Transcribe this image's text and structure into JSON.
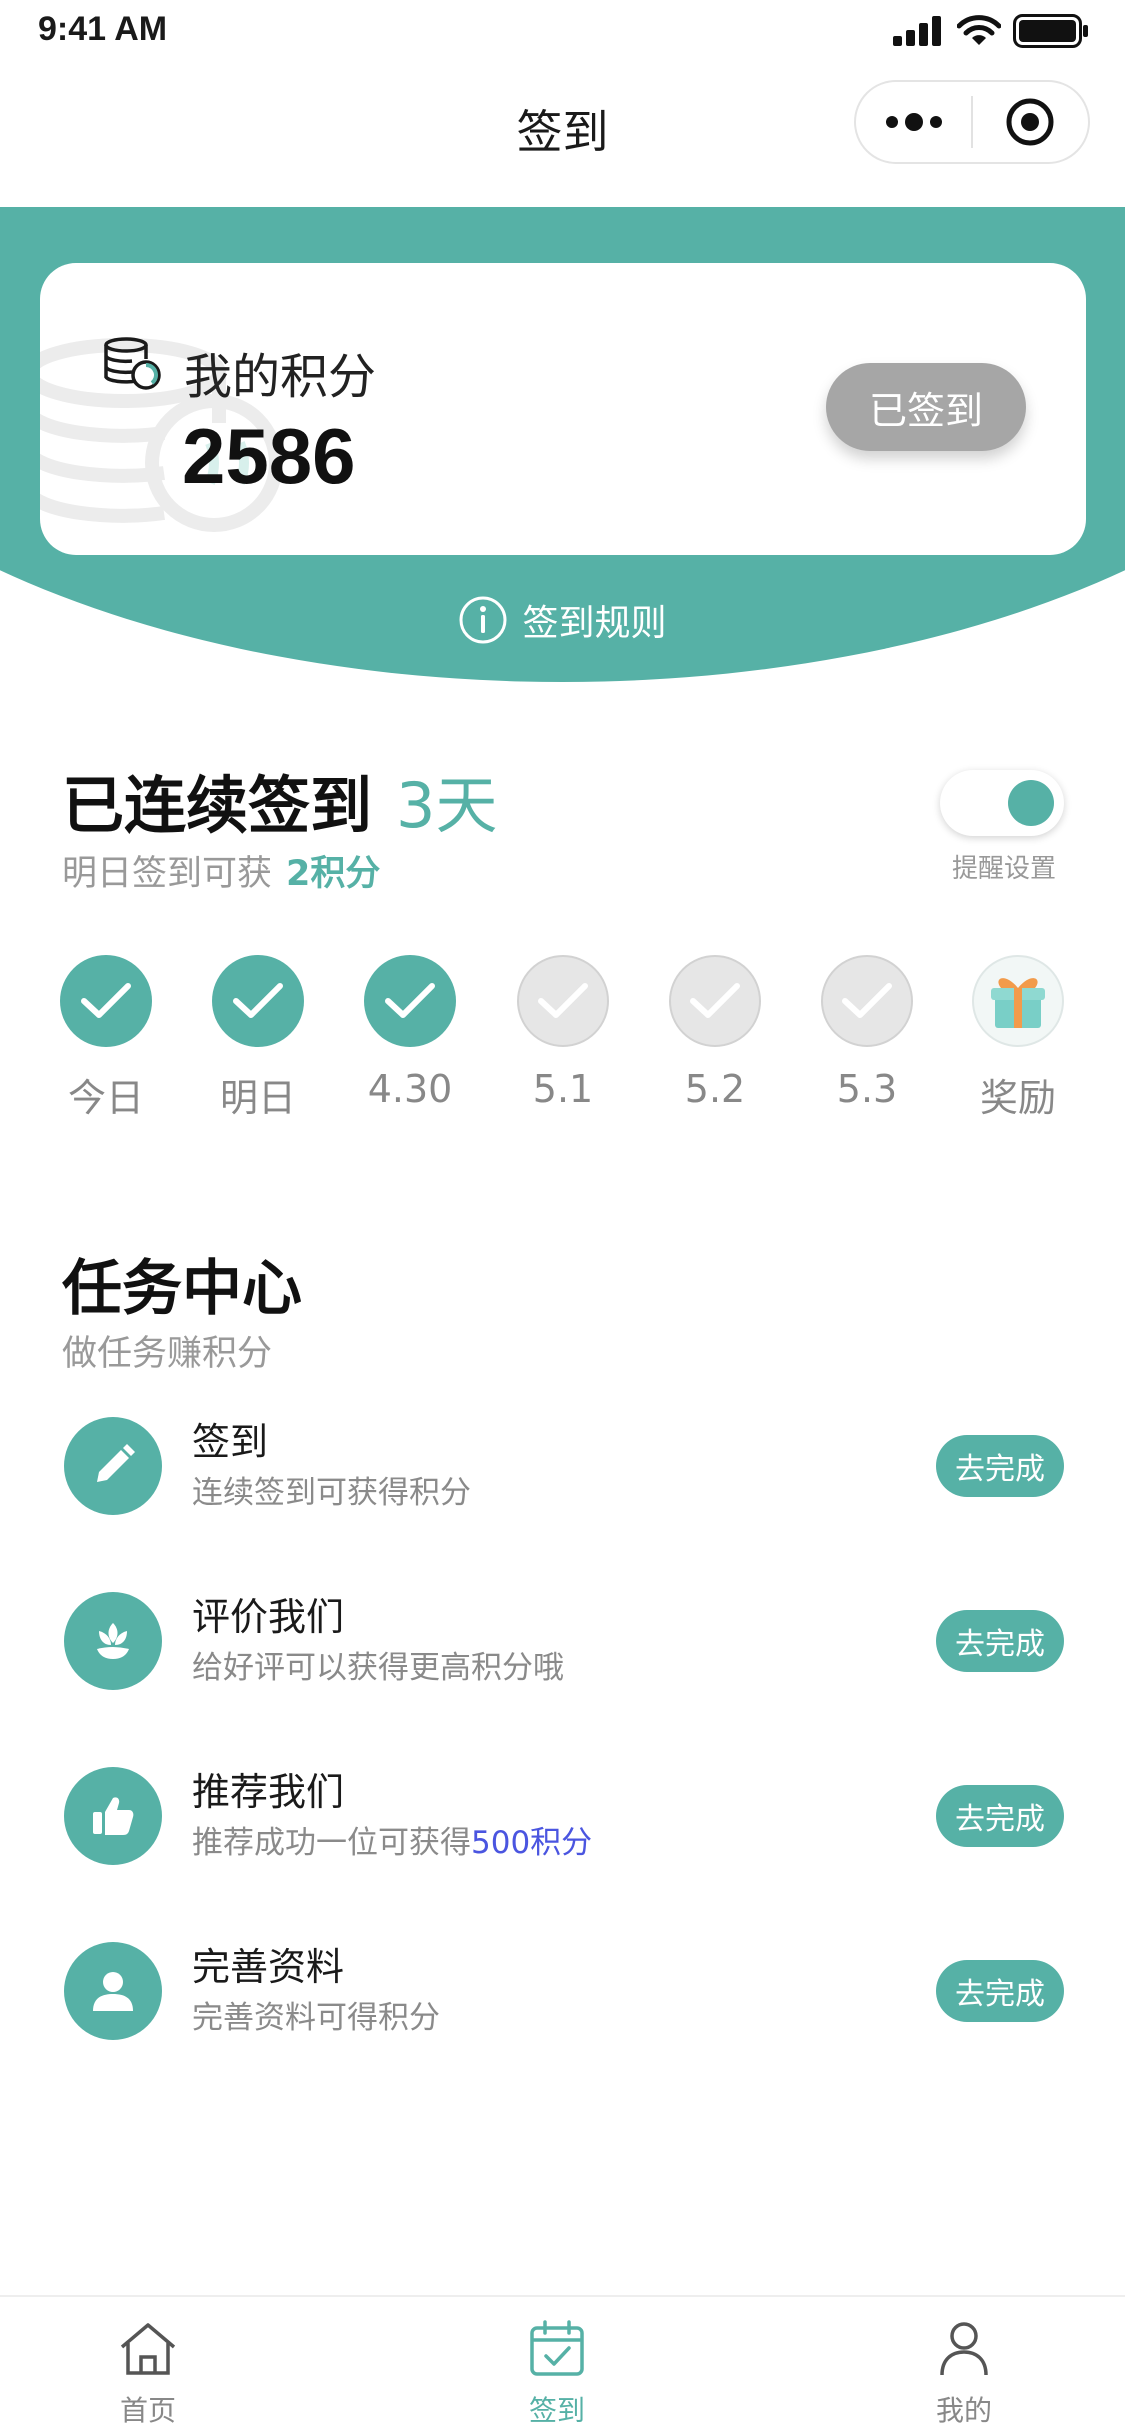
{
  "status_bar": {
    "time": "9:41 AM"
  },
  "nav": {
    "title": "签到"
  },
  "points": {
    "label": "我的积分",
    "value": "2586",
    "signed_label": "已签到",
    "rules_label": "签到规则"
  },
  "streak": {
    "title": "已连续签到",
    "days": "3天",
    "sub_prefix": "明日签到可获",
    "sub_points": "2积分",
    "reminder_label": "提醒设置",
    "reminder_on": true
  },
  "days": [
    {
      "label": "今日",
      "state": "done"
    },
    {
      "label": "明日",
      "state": "done"
    },
    {
      "label": "4.30",
      "state": "done"
    },
    {
      "label": "5.1",
      "state": "todo"
    },
    {
      "label": "5.2",
      "state": "todo"
    },
    {
      "label": "5.3",
      "state": "todo"
    },
    {
      "label": "奖励",
      "state": "gift"
    }
  ],
  "tasks": {
    "title": "任务中心",
    "subtitle": "做任务赚积分",
    "items": [
      {
        "name": "签到",
        "desc": "连续签到可获得积分",
        "desc_hl": "",
        "button": "去完成",
        "icon": "pencil-icon"
      },
      {
        "name": "评价我们",
        "desc": "给好评可以获得更高积分哦",
        "desc_hl": "",
        "button": "去完成",
        "icon": "flower-icon"
      },
      {
        "name": "推荐我们",
        "desc": "推荐成功一位可获得",
        "desc_hl": "500积分",
        "button": "去完成",
        "icon": "thumbs-up-icon"
      },
      {
        "name": "完善资料",
        "desc": "完善资料可得积分",
        "desc_hl": "",
        "button": "去完成",
        "icon": "user-icon"
      }
    ]
  },
  "tabs": [
    {
      "label": "首页",
      "icon": "home-icon",
      "active": false
    },
    {
      "label": "签到",
      "icon": "calendar-check-icon",
      "active": true
    },
    {
      "label": "我的",
      "icon": "profile-icon",
      "active": false
    }
  ],
  "colors": {
    "accent": "#56b1a6",
    "signed_button": "#a6a6a6",
    "highlight_blue": "#4a55e0"
  }
}
